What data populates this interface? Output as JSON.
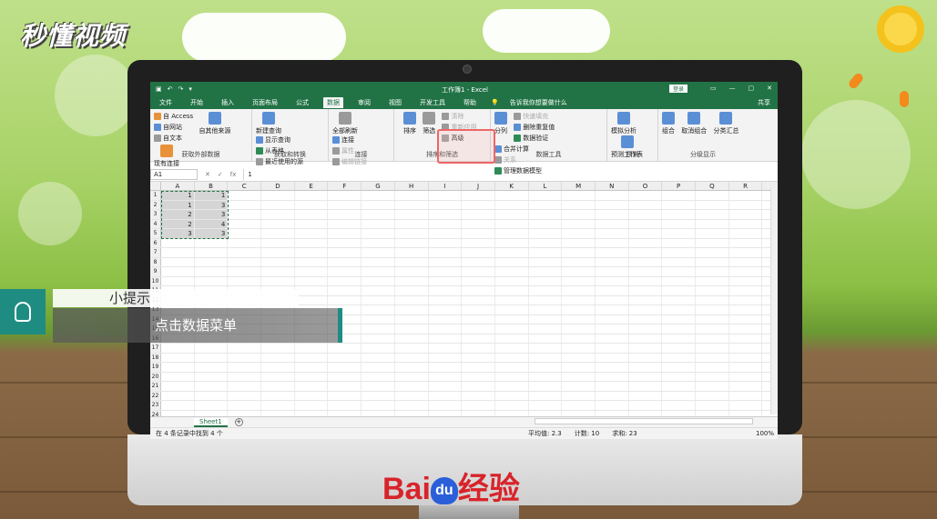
{
  "brand_logo": "秒懂视频",
  "window": {
    "title": "工作簿1 - Excel",
    "login": "登录",
    "qat": [
      "▣",
      "↶",
      "↷",
      "▾"
    ],
    "controls": [
      "▭",
      "—",
      "▢",
      "✕"
    ]
  },
  "ribbon_tabs": [
    "文件",
    "开始",
    "插入",
    "页面布局",
    "公式",
    "数据",
    "审阅",
    "视图",
    "开发工具",
    "帮助"
  ],
  "active_tab": "数据",
  "tell_me": "告诉我你想要做什么",
  "share": "共享",
  "groups": {
    "external": {
      "name": "获取外部数据",
      "small": [
        "自 Access",
        "自网站",
        "自文本"
      ],
      "big": [
        "自其他来源",
        "现有连接"
      ]
    },
    "transform": {
      "name": "获取和转换",
      "big": "新建查询",
      "small": [
        "显示查询",
        "从表格",
        "最近使用的源"
      ]
    },
    "connections": {
      "name": "连接",
      "big": "全部刷新",
      "small": [
        "连接",
        "属性",
        "编辑链接"
      ]
    },
    "sort": {
      "name": "排序和筛选",
      "big": [
        "排序",
        "筛选"
      ],
      "small": [
        "清除",
        "重新应用",
        "高级"
      ]
    },
    "datatools": {
      "name": "数据工具",
      "big": "分列",
      "small": [
        "快速填充",
        "删除重复值",
        "数据验证",
        "合并计算",
        "关系",
        "管理数据模型"
      ]
    },
    "forecast": {
      "name": "预测",
      "big": [
        "模拟分析",
        "预测工作表"
      ]
    },
    "outline": {
      "name": "分级显示",
      "big": [
        "组合",
        "取消组合",
        "分类汇总"
      ]
    }
  },
  "formula": {
    "namebox": "A1",
    "fx": "fx",
    "value": "1"
  },
  "columns": [
    "A",
    "B",
    "C",
    "D",
    "E",
    "F",
    "G",
    "H",
    "I",
    "J",
    "K",
    "L",
    "M",
    "N",
    "O",
    "P",
    "Q",
    "R"
  ],
  "rows": [
    [
      "1",
      "1"
    ],
    [
      "1",
      "3"
    ],
    [
      "2",
      "3"
    ],
    [
      "2",
      "4"
    ],
    [
      "3",
      "3"
    ],
    [
      "",
      ""
    ],
    [
      "",
      ""
    ],
    [
      "",
      ""
    ],
    [
      "",
      ""
    ],
    [
      "",
      ""
    ],
    [
      "",
      ""
    ],
    [
      "",
      ""
    ],
    [
      "",
      ""
    ],
    [
      "",
      ""
    ],
    [
      "",
      ""
    ],
    [
      "",
      ""
    ],
    [
      "",
      ""
    ],
    [
      "",
      ""
    ],
    [
      "",
      ""
    ],
    [
      "",
      ""
    ],
    [
      "",
      ""
    ],
    [
      "",
      ""
    ],
    [
      "",
      ""
    ],
    [
      "",
      ""
    ]
  ],
  "sheet": {
    "tab": "Sheet1",
    "add": "+"
  },
  "status": {
    "left": "在 4 条记录中找到 4 个",
    "average": "平均值: 2.3",
    "count": "计数: 10",
    "sum": "求和: 23",
    "zoom": "100%"
  },
  "tip": {
    "title": "小提示",
    "body": "点击数据菜单"
  },
  "watermark": {
    "bai": "Bai",
    "du": "du",
    "jingyan": "经验"
  }
}
